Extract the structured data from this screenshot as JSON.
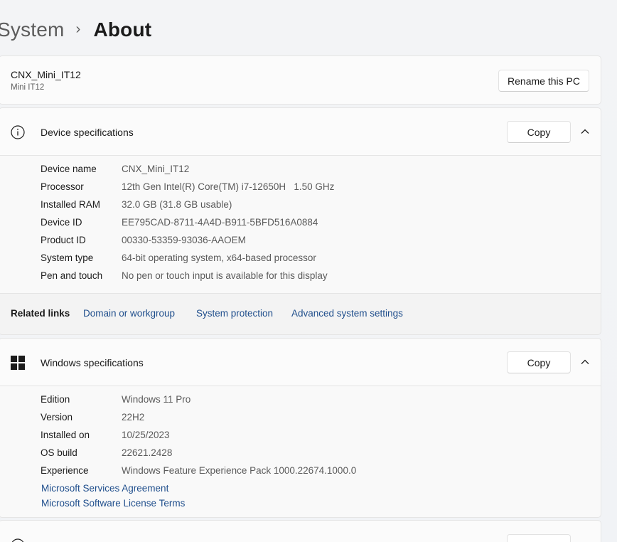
{
  "breadcrumb": {
    "parent": "System",
    "separator": "›",
    "current": "About"
  },
  "pc": {
    "name": "CNX_Mini_IT12",
    "model": "Mini IT12",
    "rename_label": "Rename this PC"
  },
  "device_specs": {
    "title": "Device specifications",
    "icon": "info-icon",
    "copy_label": "Copy",
    "rows": [
      {
        "label": "Device name",
        "value": "CNX_Mini_IT12"
      },
      {
        "label": "Processor",
        "value": "12th Gen Intel(R) Core(TM) i7-12650H   1.50 GHz"
      },
      {
        "label": "Installed RAM",
        "value": "32.0 GB (31.8 GB usable)"
      },
      {
        "label": "Device ID",
        "value": "EE795CAD-8711-4A4D-B911-5BFD516A0884"
      },
      {
        "label": "Product ID",
        "value": "00330-53359-93036-AAOEM"
      },
      {
        "label": "System type",
        "value": "64-bit operating system, x64-based processor"
      },
      {
        "label": "Pen and touch",
        "value": "No pen or touch input is available for this display"
      }
    ]
  },
  "related_links": {
    "label": "Related links",
    "links": [
      "Domain or workgroup",
      "System protection",
      "Advanced system settings"
    ]
  },
  "windows_specs": {
    "title": "Windows specifications",
    "icon": "windows-logo-icon",
    "copy_label": "Copy",
    "rows": [
      {
        "label": "Edition",
        "value": "Windows 11 Pro"
      },
      {
        "label": "Version",
        "value": "22H2"
      },
      {
        "label": "Installed on",
        "value": "10/25/2023"
      },
      {
        "label": "OS build",
        "value": "22621.2428"
      },
      {
        "label": "Experience",
        "value": "Windows Feature Experience Pack 1000.22674.1000.0"
      }
    ],
    "links": [
      "Microsoft Services Agreement",
      "Microsoft Software License Terms"
    ]
  },
  "colors": {
    "link": "#1f4e8c",
    "background": "#f3f3f3",
    "card": "#fbfbfb"
  }
}
